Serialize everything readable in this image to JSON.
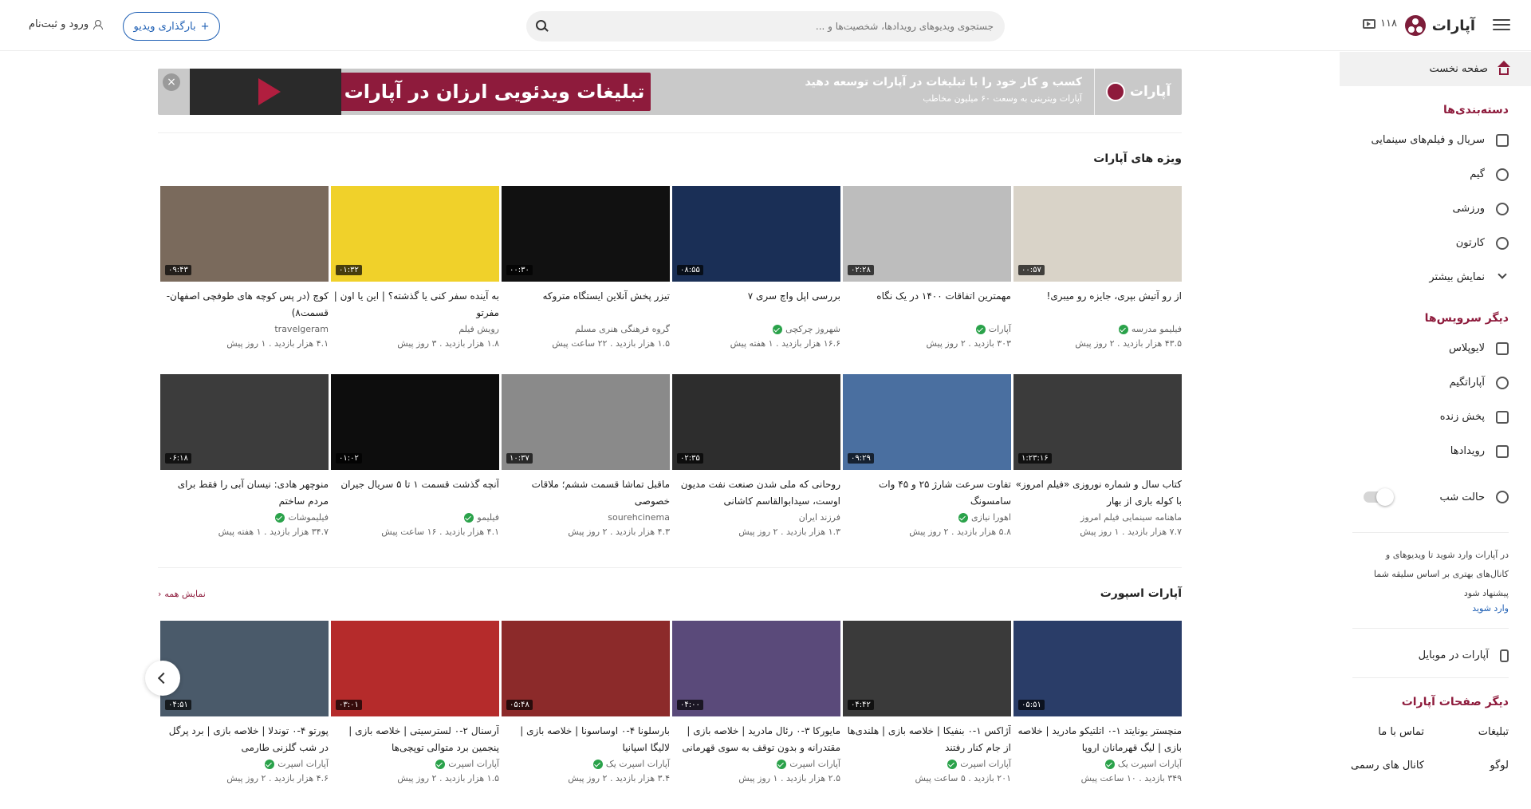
{
  "header": {
    "logo_text": "آپارات",
    "notification_count": "۱۱۸",
    "search_placeholder": "جستجوی ویدیوهای رویدادها، شخصیت‌ها و ...",
    "upload_label": "بارگذاری ویدیو",
    "login_label": "ورود و ثبت‌نام"
  },
  "sidebar": {
    "home": "صفحه نخست",
    "categories_title": "دسته‌بندی‌ها",
    "categories": [
      "سریال و فیلم‌های سینمایی",
      "گیم",
      "ورزشی",
      "کارتون",
      "نمایش بیشتر"
    ],
    "services_title": "دیگر سرویس‌ها",
    "services": [
      "لایوپلاس",
      "آپاراتگیم",
      "پخش زنده",
      "رویدادها"
    ],
    "night_mode": "حالت شب",
    "login_note": "در آپارات وارد شوید تا ویدیوهای و کانال‌های بهتری بر اساس سلیقه شما پیشنهاد شود",
    "login_link": "وارد شوید",
    "mobile": "آپارات در موبایل",
    "other_pages_title": "دیگر صفحات آپارات",
    "other_pages": [
      "تبلیغات",
      "تماس با ما",
      "لوگو",
      "کانال های رسمی"
    ]
  },
  "banner": {
    "brand": "آپارات",
    "title": "کسب و کار خود را با تبلیغات در آپارات توسعه دهید",
    "subtitle": "آپارات ویترینی به وسعت ۶۰ میلیون مخاطب",
    "ad_text": "تبلیغات ویدئویی ارزان در آپارات",
    "close": "×"
  },
  "featured": {
    "title": "ویژه های آپارات",
    "videos": [
      {
        "title": "از رو آتیش بپری، جایزه رو میبری!",
        "channel": "فیلیمو مدرسه",
        "verified": true,
        "views": "۴۳.۵ هزار بازدید",
        "age": "۲ روز پیش",
        "duration": "۰۰:۵۷",
        "color": "#d9d3c8"
      },
      {
        "title": "مهمترین اتفاقات ۱۴۰۰ در یک نگاه",
        "channel": "آپارات",
        "verified": true,
        "views": "۳۰۳ بازدید",
        "age": "۲ روز پیش",
        "duration": "۰۲:۲۸",
        "color": "#bdbdbd"
      },
      {
        "title": "بررسی اپل واچ سری ۷",
        "channel": "شهروز چرکچی",
        "verified": true,
        "views": "۱۶.۶ هزار بازدید",
        "age": "۱ هفته پیش",
        "duration": "۰۸:۵۵",
        "color": "#1a2f56"
      },
      {
        "title": "تیزر پخش آنلاین ایستگاه متروکه",
        "channel": "گروه فرهنگی هنری مسلم",
        "verified": false,
        "views": "۱.۵ هزار بازدید",
        "age": "۲۲ ساعت پیش",
        "duration": "۰۰:۳۰",
        "color": "#111111"
      },
      {
        "title": "به آینده سفر کنی یا گذشته؟ | این یا اون | مفرتو",
        "channel": "رویش فیلم",
        "verified": false,
        "views": "۱.۸ هزار بازدید",
        "age": "۳ روز پیش",
        "duration": "۰۱:۳۲",
        "color": "#f0d12a"
      },
      {
        "title": "کوچ (در پس کوچه های طوفچی اصفهان- قسمت۸)",
        "channel": "travelgeram",
        "verified": false,
        "views": "۴.۱ هزار بازدید",
        "age": "۱ روز پیش",
        "duration": "۰۹:۴۳",
        "color": "#7a6a5c"
      },
      {
        "title": "کتاب سال و شماره نوروزی «فیلم امروز» با کوله باری از بهار",
        "channel": "ماهنامه سینمایی فیلم امروز",
        "verified": false,
        "views": "۷.۷ هزار بازدید",
        "age": "۱ روز پیش",
        "duration": "۱:۲۳:۱۶",
        "color": "#3b3b3b"
      },
      {
        "title": "تفاوت سرعت شارژ ۲۵ و ۴۵ وات سامسونگ",
        "channel": "اهورا نیازی",
        "verified": true,
        "views": "۵.۸ هزار بازدید",
        "age": "۲ روز پیش",
        "duration": "۰۹:۲۹",
        "color": "#4a6fa0"
      },
      {
        "title": "روحانی که ملی شدن صنعت نفت مدیون اوست، سیدابوالقاسم کاشانی",
        "channel": "فرزند ایران",
        "verified": false,
        "views": "۱.۳ هزار بازدید",
        "age": "۲ روز پیش",
        "duration": "۰۲:۳۵",
        "color": "#2d2d2d"
      },
      {
        "title": "ماقبل تماشا قسمت ششم؛ ملاقات خصوصی",
        "channel": "sourehcinema",
        "verified": false,
        "views": "۴.۳ هزار بازدید",
        "age": "۲ روز پیش",
        "duration": "۱۰:۳۷",
        "color": "#8a8a8a"
      },
      {
        "title": "آنچه گذشت قسمت ۱ تا ۵ سریال جیران",
        "channel": "فیلیمو",
        "verified": true,
        "views": "۴.۱ هزار بازدید",
        "age": "۱۶ ساعت پیش",
        "duration": "۰۱:۰۲",
        "color": "#0d0d0d"
      },
      {
        "title": "منوچهر هادی: نیسان آبی را فقط برای مردم ساختم",
        "channel": "فیلیموشات",
        "verified": true,
        "views": "۳۴.۷ هزار بازدید",
        "age": "۱ هفته پیش",
        "duration": "۰۶:۱۸",
        "color": "#3c3c3c"
      }
    ]
  },
  "sport": {
    "title": "آپارات اسپورت",
    "more": "نمایش همه",
    "videos": [
      {
        "title": "منچستر یونایتد ۱-۰ اتلتیکو مادرید | خلاصه بازی | لیگ قهرمانان اروپا",
        "channel": "آپارات اسپرت یک",
        "verified": true,
        "views": "۳۴۹ بازدید",
        "age": "۱۰ ساعت پیش",
        "duration": "۰۵:۵۱",
        "color": "#2a3d68"
      },
      {
        "title": "آژاکس ۱-۰ بنفیکا | خلاصه بازی | هلندی‌ها از جام کنار رفتند",
        "channel": "آپارات اسپرت",
        "verified": true,
        "views": "۲۰۱ بازدید",
        "age": "۵ ساعت پیش",
        "duration": "۰۴:۴۲",
        "color": "#3a3a3a"
      },
      {
        "title": "مایورکا ۳-۰ رئال مادرید | خلاصه بازی | مقتدرانه و بدون توقف به سوی قهرمانی",
        "channel": "آپارات اسپرت",
        "verified": true,
        "views": "۲.۵ هزار بازدید",
        "age": "۱ روز پیش",
        "duration": "۰۴:۰۰",
        "color": "#5a4a7a"
      },
      {
        "title": "بارسلونا ۴-۰ اوساسونا | خلاصه بازی | لالیگا اسپانیا",
        "channel": "آپارات اسپرت یک",
        "verified": true,
        "views": "۳.۴ هزار بازدید",
        "age": "۲ روز پیش",
        "duration": "۰۵:۴۸",
        "color": "#8c2a2a"
      },
      {
        "title": "آرسنال ۲-۰ لسترسیتی | خلاصه بازی | پنجمین برد متوالی توپچی‌ها",
        "channel": "آپارات اسپرت",
        "verified": true,
        "views": "۱.۵ هزار بازدید",
        "age": "۲ روز پیش",
        "duration": "۰۳:۰۱",
        "color": "#b52b2b"
      },
      {
        "title": "پورتو ۴-۰ توندلا | خلاصه بازی | برد پرگل در شب گلزنی طارمی",
        "channel": "آپارات اسپرت",
        "verified": true,
        "views": "۴.۶ هزار بازدید",
        "age": "۲ روز پیش",
        "duration": "۰۴:۵۱",
        "color": "#4a5a6a"
      }
    ]
  }
}
